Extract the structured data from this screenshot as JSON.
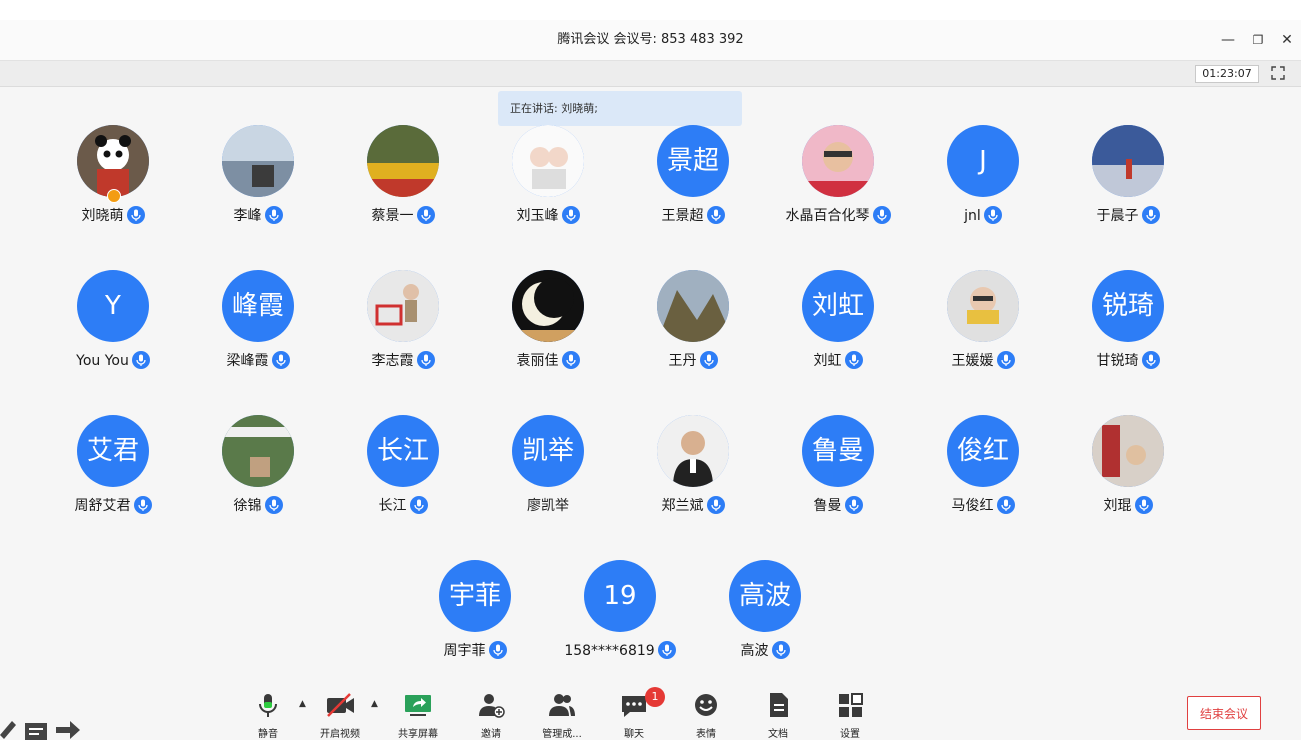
{
  "window": {
    "title": "腾讯会议 会议号: 853 483 392",
    "minimize_icon": "—",
    "restore_icon": "❐",
    "close_icon": "✕"
  },
  "meeting": {
    "timer": "01:23:07",
    "speaking_label": "正在讲话: 刘晓萌;"
  },
  "participants": [
    {
      "name": "刘晓萌",
      "avatar_text": "",
      "photo": "panda"
    },
    {
      "name": "李峰",
      "avatar_text": "",
      "photo": "lake"
    },
    {
      "name": "蔡景一",
      "avatar_text": "",
      "photo": "flowers"
    },
    {
      "name": "刘玉峰",
      "avatar_text": "",
      "photo": "cartoon"
    },
    {
      "name": "王景超",
      "avatar_text": "景超",
      "photo": ""
    },
    {
      "name": "水晶百合化琴",
      "avatar_text": "",
      "photo": "woman"
    },
    {
      "name": "jnl",
      "avatar_text": "J",
      "photo": ""
    },
    {
      "name": "于晨子",
      "avatar_text": "",
      "photo": "sky"
    },
    {
      "name": "You You",
      "avatar_text": "Y",
      "photo": ""
    },
    {
      "name": "梁峰霞",
      "avatar_text": "峰霞",
      "photo": ""
    },
    {
      "name": "李志霞",
      "avatar_text": "",
      "photo": "child"
    },
    {
      "name": "袁丽佳",
      "avatar_text": "",
      "photo": "moon"
    },
    {
      "name": "王丹",
      "avatar_text": "",
      "photo": "mountain"
    },
    {
      "name": "刘虹",
      "avatar_text": "刘虹",
      "photo": ""
    },
    {
      "name": "王媛媛",
      "avatar_text": "",
      "photo": "scarf"
    },
    {
      "name": "甘锐琦",
      "avatar_text": "锐琦",
      "photo": ""
    },
    {
      "name": "周舒艾君",
      "avatar_text": "艾君",
      "photo": ""
    },
    {
      "name": "徐锦",
      "avatar_text": "",
      "photo": "garden"
    },
    {
      "name": "长江",
      "avatar_text": "长江",
      "photo": ""
    },
    {
      "name": "廖凯举",
      "avatar_text": "凯举",
      "photo": ""
    },
    {
      "name": "郑兰斌",
      "avatar_text": "",
      "photo": "man"
    },
    {
      "name": "鲁曼",
      "avatar_text": "鲁曼",
      "photo": ""
    },
    {
      "name": "马俊红",
      "avatar_text": "俊红",
      "photo": ""
    },
    {
      "name": "刘琨",
      "avatar_text": "",
      "photo": "building"
    },
    {
      "name": "周宇菲",
      "avatar_text": "宇菲",
      "photo": ""
    },
    {
      "name": "158****6819",
      "avatar_text": "19",
      "photo": ""
    },
    {
      "name": "高波",
      "avatar_text": "高波",
      "photo": ""
    }
  ],
  "toolbar": {
    "mute": "静音",
    "video": "开启视频",
    "share": "共享屏幕",
    "invite": "邀请",
    "manage": "管理成...",
    "chat": "聊天",
    "chat_badge": "1",
    "emoji": "表情",
    "docs": "文档",
    "settings": "设置",
    "end_meeting": "结束会议"
  },
  "colors": {
    "accent": "#2d7df6",
    "end": "#e04040",
    "badge": "#e53935"
  }
}
